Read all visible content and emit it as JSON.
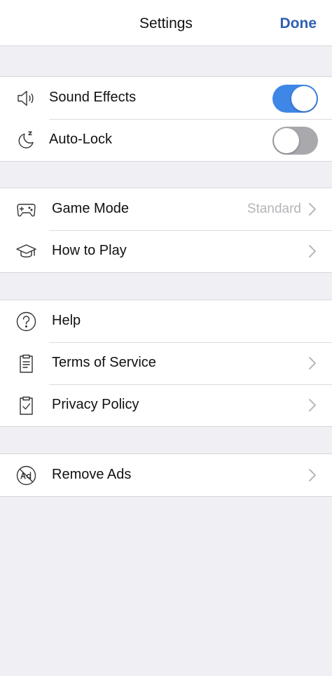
{
  "navbar": {
    "title": "Settings",
    "done_label": "Done"
  },
  "groups": [
    {
      "rows": [
        {
          "icon": "speaker-icon",
          "label": "Sound Effects",
          "control": "toggle",
          "on": true
        },
        {
          "icon": "moon-icon",
          "label": "Auto-Lock",
          "control": "toggle",
          "on": false
        }
      ]
    },
    {
      "rows": [
        {
          "icon": "gamepad-icon",
          "label": "Game Mode",
          "value": "Standard",
          "control": "chevron"
        },
        {
          "icon": "graduation-cap-icon",
          "label": "How to Play",
          "control": "chevron"
        }
      ]
    },
    {
      "rows": [
        {
          "icon": "question-circle-icon",
          "label": "Help"
        },
        {
          "icon": "clipboard-list-icon",
          "label": "Terms of Service",
          "control": "chevron"
        },
        {
          "icon": "clipboard-check-icon",
          "label": "Privacy Policy",
          "control": "chevron"
        }
      ]
    },
    {
      "rows": [
        {
          "icon": "no-ads-icon",
          "label": "Remove Ads",
          "control": "chevron"
        }
      ]
    }
  ],
  "colors": {
    "accent": "#3f87e6",
    "done": "#2f5fb3",
    "toggle_off": "#a9a9ad",
    "background": "#efeff4"
  }
}
